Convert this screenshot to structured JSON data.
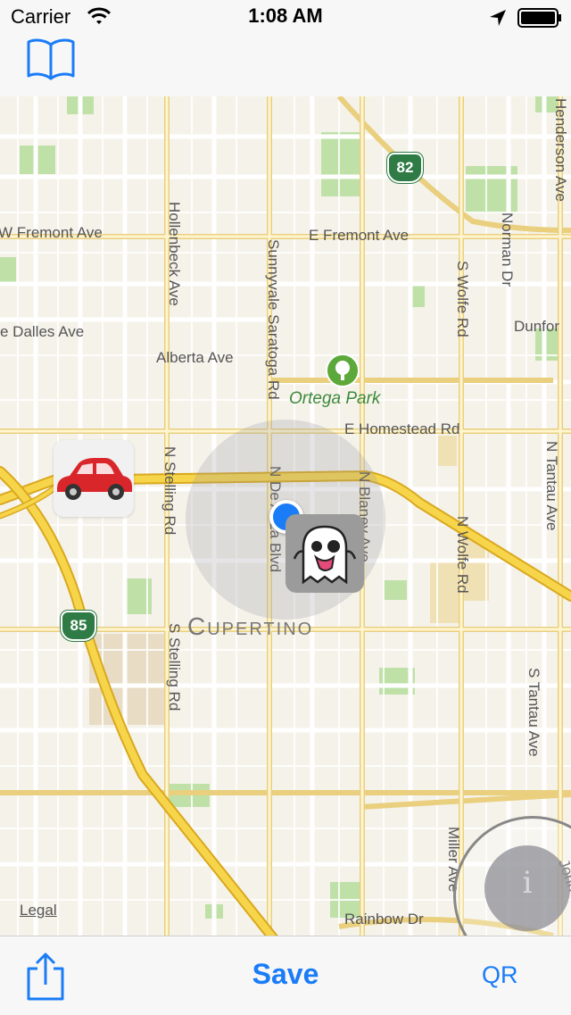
{
  "status_bar": {
    "carrier": "Carrier",
    "time": "1:08 AM"
  },
  "nav": {
    "bookmarks_icon": "book-icon"
  },
  "map": {
    "streets": {
      "w_fremont": "W Fremont Ave",
      "e_fremont": "E Fremont Ave",
      "dalles": "e Dalles Ave",
      "alberta": "Alberta Ave",
      "e_homestead": "E Homestead Rd",
      "hollenbeck": "Hollenbeck Ave",
      "sunnyvale_saratoga": "Sunnyvale Saratoga Rd",
      "n_stelling": "N Stelling Rd",
      "s_stelling": "S Stelling Rd",
      "n_de_anza": "N De Anza Blvd",
      "n_blaney": "N Blaney Ave",
      "s_wolfe": "S Wolfe Rd",
      "n_wolfe": "N Wolfe Rd",
      "norman": "Norman Dr",
      "henderson": "Henderson Ave",
      "dunford": "Dunfor",
      "n_tantau": "N Tantau Ave",
      "s_tantau": "S Tantau Ave",
      "miller": "Miller Ave",
      "rainbow": "Rainbow Dr",
      "johnson": "John"
    },
    "park_name": "Ortega Park",
    "city": "Cupertino",
    "highway_82": "82",
    "highway_85": "85",
    "legal": "Legal",
    "car_emoji": "🚗",
    "ghost_emoji": "👻",
    "info_glyph": "i",
    "colors": {
      "road_major": "#f7d54a",
      "road_major_edge": "#d9a81e",
      "road_minor": "#ffffff",
      "park": "#bfe1a8",
      "land": "#f5f2ea",
      "user_location": "#1a7cf7"
    }
  },
  "toolbar": {
    "share_icon": "share-icon",
    "save_label": "Save",
    "qr_label": "QR"
  }
}
